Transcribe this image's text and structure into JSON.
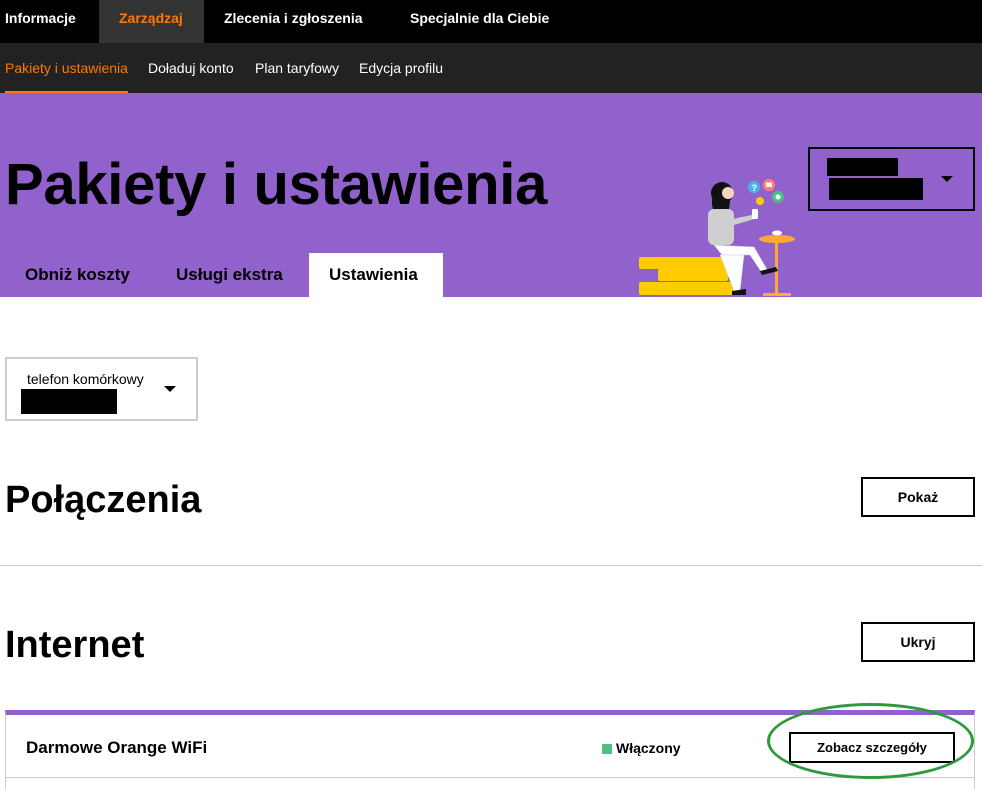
{
  "top_nav": {
    "items": [
      {
        "label": "Informacje"
      },
      {
        "label": "Zarządzaj"
      },
      {
        "label": "Zlecenia i zgłoszenia"
      },
      {
        "label": "Specjalnie dla Ciebie"
      }
    ],
    "active": "Zarządzaj"
  },
  "sub_nav": {
    "items": [
      {
        "label": "Pakiety i ustawienia"
      },
      {
        "label": "Doładuj konto"
      },
      {
        "label": "Plan taryfowy"
      },
      {
        "label": "Edycja profilu"
      }
    ],
    "active": "Pakiety i ustawienia"
  },
  "hero": {
    "title": "Pakiety i ustawienia",
    "tabs": [
      {
        "label": "Obniż koszty"
      },
      {
        "label": "Usługi ekstra"
      },
      {
        "label": "Ustawienia"
      }
    ],
    "active_tab": "Ustawienia"
  },
  "phone_select": {
    "label": "telefon komórkowy"
  },
  "sections": {
    "connections": {
      "title": "Połączenia",
      "button": "Pokaż"
    },
    "internet": {
      "title": "Internet",
      "button": "Ukryj"
    }
  },
  "internet_items": [
    {
      "name": "Darmowe Orange WiFi",
      "status": "Włączony",
      "button": "Zobacz szczegóły"
    }
  ],
  "colors": {
    "accent": "#ff7900",
    "hero_bg": "#9162cc",
    "status_on": "#50be87",
    "highlight": "#2e9a3c"
  }
}
